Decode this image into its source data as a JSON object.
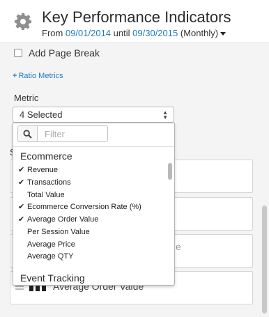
{
  "header": {
    "title": "Key Performance Indicators",
    "from_label": "From",
    "start_date": "09/01/2014",
    "until_label": "until",
    "end_date": "09/30/2015",
    "granularity": "(Monthly)"
  },
  "settings": {
    "page_break_label": "Add Page Break",
    "page_break_checked": false,
    "ratio_metrics_label": "Ratio Metrics",
    "metric_label": "Metric",
    "metric_selected": "4 Selected",
    "partial_section_label": "S"
  },
  "dropdown": {
    "filter_placeholder": "Filter",
    "groups": [
      {
        "name": "Ecommerce",
        "options": [
          {
            "label": "Revenue",
            "checked": true
          },
          {
            "label": "Transactions",
            "checked": true
          },
          {
            "label": "Total Value",
            "checked": false
          },
          {
            "label": "Ecommerce Conversion Rate (%)",
            "checked": true
          },
          {
            "label": "Average Order Value",
            "checked": true
          },
          {
            "label": "Per Session Value",
            "checked": false
          },
          {
            "label": "Average Price",
            "checked": false
          },
          {
            "label": "Average QTY",
            "checked": false
          }
        ]
      },
      {
        "name": "Event Tracking",
        "options": []
      }
    ]
  },
  "cards": {
    "peek_text": "e",
    "last_card_label": "Average Order Value"
  },
  "colors": {
    "link": "#1f7ac2",
    "panel_bg": "#f4f4f4"
  }
}
